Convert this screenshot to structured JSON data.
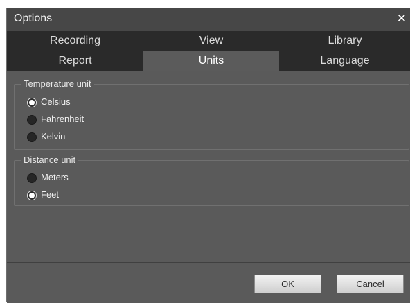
{
  "window": {
    "title": "Options",
    "close_glyph": "✕"
  },
  "tabs": {
    "row1": [
      {
        "label": "Recording"
      },
      {
        "label": "View"
      },
      {
        "label": "Library"
      }
    ],
    "row2": [
      {
        "label": "Report"
      },
      {
        "label": "Units",
        "active": true
      },
      {
        "label": "Language"
      }
    ]
  },
  "temperature": {
    "title": "Temperature unit",
    "options": [
      {
        "label": "Celsius",
        "checked": true
      },
      {
        "label": "Fahrenheit",
        "checked": false
      },
      {
        "label": "Kelvin",
        "checked": false
      }
    ]
  },
  "distance": {
    "title": "Distance unit",
    "options": [
      {
        "label": "Meters",
        "checked": false
      },
      {
        "label": "Feet",
        "checked": true
      }
    ]
  },
  "footer": {
    "ok_label": "OK",
    "cancel_label": "Cancel"
  }
}
